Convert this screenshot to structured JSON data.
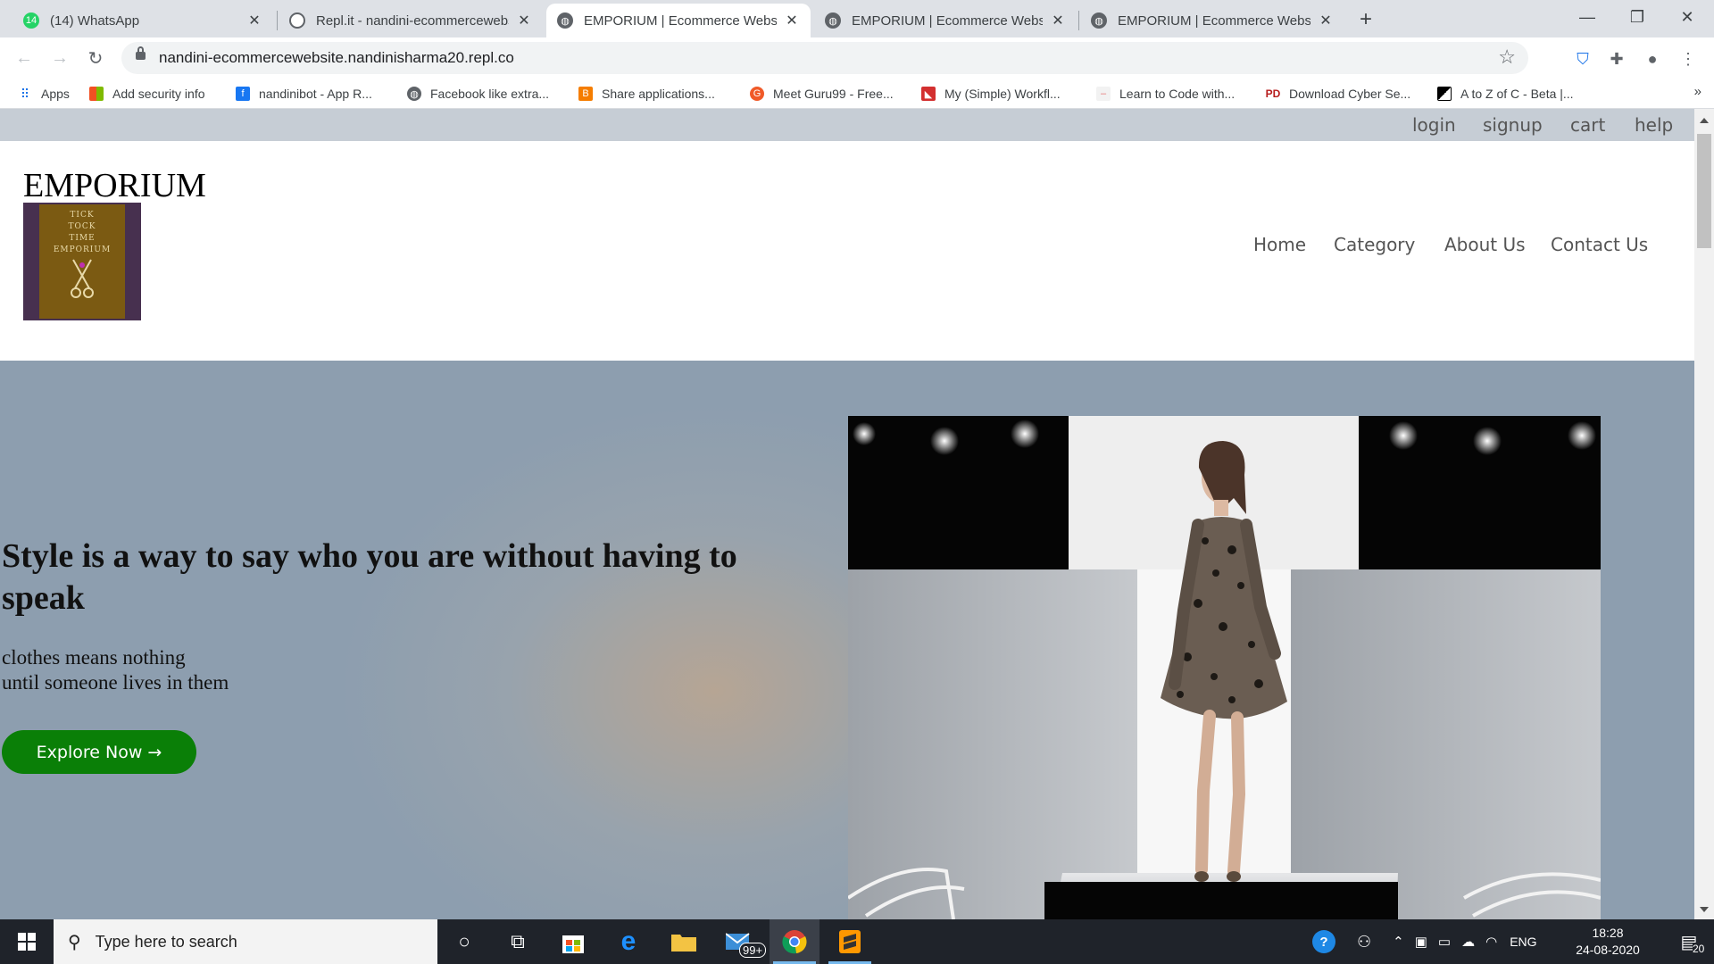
{
  "browser": {
    "tabs": [
      {
        "title": "(14) WhatsApp",
        "badge": "14",
        "icon": "whatsapp-icon",
        "active": false
      },
      {
        "title": "Repl.it - nandini-ecommercewebsite",
        "icon": "replit-icon",
        "active": false
      },
      {
        "title": "EMPORIUM | Ecommerce Website",
        "icon": "globe-icon",
        "active": true
      },
      {
        "title": "EMPORIUM | Ecommerce Website",
        "icon": "globe-icon",
        "active": false
      },
      {
        "title": "EMPORIUM | Ecommerce Website",
        "icon": "globe-icon",
        "active": false
      }
    ],
    "url": "nandini-ecommercewebsite.nandinisharma20.repl.co",
    "bookmarks": [
      {
        "label": "Apps",
        "icon": "apps-grid-icon"
      },
      {
        "label": "Add security info",
        "icon": "microsoft-icon"
      },
      {
        "label": "nandinibot - App R...",
        "icon": "facebook-icon"
      },
      {
        "label": "Facebook like extra...",
        "icon": "globe-icon"
      },
      {
        "label": "Share applications...",
        "icon": "blogger-icon"
      },
      {
        "label": "Meet Guru99 - Free...",
        "icon": "guru99-icon"
      },
      {
        "label": "My (Simple) Workfl...",
        "icon": "bookmark-icon"
      },
      {
        "label": "Learn to Code with...",
        "icon": "code-icon"
      },
      {
        "label": "Download Cyber Se...",
        "icon": "pd-icon"
      },
      {
        "label": "A to Z of C - Beta |...",
        "icon": "blocks-icon"
      }
    ],
    "bookmarks_more": "»"
  },
  "site": {
    "top_links": [
      "login",
      "signup",
      "cart",
      "help"
    ],
    "brand": "EMPORIUM",
    "logo_text": [
      "TICK",
      "TOCK",
      "TIME",
      "EMPORIUM"
    ],
    "nav": [
      "Home",
      "Category",
      "About Us",
      "Contact Us"
    ],
    "hero": {
      "heading": "Style is a way to say who you are without having to speak",
      "line1": "clothes means nothing",
      "line2": "until someone lives in them",
      "button": "Explore Now →"
    }
  },
  "taskbar": {
    "search_placeholder": "Type here to search",
    "mail_badge": "99+",
    "language": "ENG",
    "time": "18:28",
    "date": "24-08-2020",
    "notification_count": "20"
  },
  "colors": {
    "explore_button": "#0a7f07",
    "topbar": "#c6cdd5",
    "logo_bg": "#47304f"
  }
}
